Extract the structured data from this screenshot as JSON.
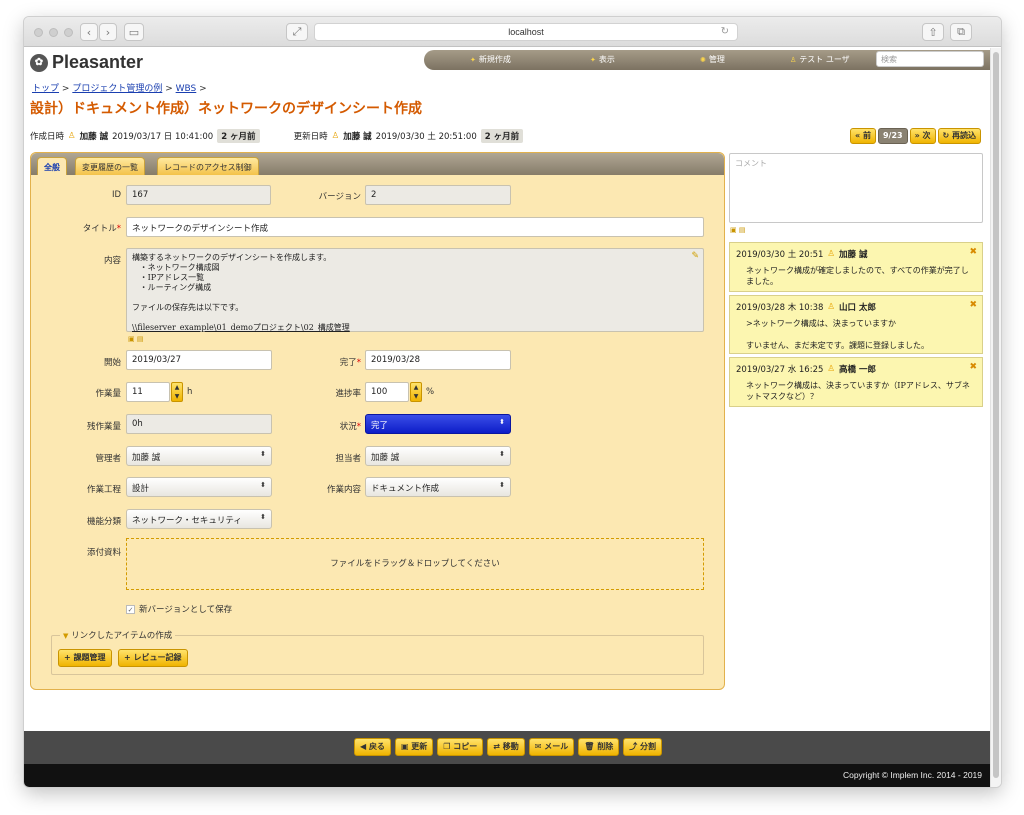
{
  "browser": {
    "url": "localhost"
  },
  "app": {
    "logo": "Pleasanter"
  },
  "nav": {
    "new": "新規作成",
    "view": "表示",
    "admin": "管理",
    "user": "テスト ユーザ",
    "search_placeholder": "検索"
  },
  "breadcrumb": {
    "top": "トップ",
    "example": "プロジェクト管理の例",
    "wbs": "WBS",
    "sep": ">"
  },
  "title": "設計）ドキュメント作成）ネットワークのデザインシート作成",
  "meta": {
    "created_label": "作成日時",
    "created_by": "加藤 誠",
    "created_at": "2019/03/17 日 10:41:00",
    "created_ago": "2 ヶ月前",
    "updated_label": "更新日時",
    "updated_by": "加藤 誠",
    "updated_at": "2019/03/30 土 20:51:00",
    "updated_ago": "2 ヶ月前"
  },
  "pager": {
    "prev": "前",
    "count": "9/23",
    "next": "次",
    "reload": "再読込"
  },
  "tabs": [
    "全般",
    "変更履歴の一覧",
    "レコードのアクセス制御"
  ],
  "form": {
    "id_label": "ID",
    "id": "167",
    "version_label": "バージョン",
    "version": "2",
    "title_label": "タイトル",
    "title": "ネットワークのデザインシート作成",
    "body_label": "内容",
    "body_lines": [
      "構築するネットワークのデザインシートを作成します。",
      "   ・ネットワーク構成図",
      "   ・IPアドレス一覧",
      "   ・ルーティング構成",
      "",
      "ファイルの保存先は以下です。",
      ""
    ],
    "body_link": "\\\\fileserver_example\\01_demoプロジェクト\\02_構成管理",
    "start_label": "開始",
    "start": "2019/03/27",
    "complete_label": "完了",
    "complete": "2019/03/28",
    "work_label": "作業量",
    "work": "11",
    "work_unit": "h",
    "progress_label": "進捗率",
    "progress": "100",
    "progress_unit": "%",
    "remain_label": "残作業量",
    "remain": "0h",
    "status_label": "状況",
    "status": "完了",
    "manager_label": "管理者",
    "manager": "加藤 誠",
    "owner_label": "担当者",
    "owner": "加藤 誠",
    "process_label": "作業工程",
    "process": "設計",
    "content_label": "作業内容",
    "content": "ドキュメント作成",
    "category_label": "機能分類",
    "category": "ネットワーク・セキュリティ",
    "attach_label": "添付資料",
    "dropzone": "ファイルをドラッグ＆ドロップしてください",
    "new_version": "新バージョンとして保存",
    "linked_legend": "リンクしたアイテムの作成",
    "linked_issue": "課題管理",
    "linked_review": "レビュー記録"
  },
  "comments": {
    "placeholder": "コメント",
    "items": [
      {
        "date": "2019/03/30 土 20:51",
        "author": "加藤 誠",
        "body": "ネットワーク構成が確定しましたので、すべての作業が完了しました。"
      },
      {
        "date": "2019/03/28 木 10:38",
        "author": "山口 太郎",
        "body": ">ネットワーク構成は、決まっていますか\n\nすいません、まだ未定です。課題に登録しました。"
      },
      {
        "date": "2019/03/27 水 16:25",
        "author": "高橋 一郎",
        "body": "ネットワーク構成は、決まっていますか（IPアドレス、サブネットマスクなど）？"
      }
    ]
  },
  "footer": {
    "back": "戻る",
    "update": "更新",
    "copy": "コピー",
    "move": "移動",
    "mail": "メール",
    "delete": "削除",
    "split": "分割",
    "copyright": "Copyright © Implem Inc. 2014 - 2019"
  },
  "colors": {
    "accent": "#f0b400",
    "title": "#d45a00",
    "panel": "#fce8b2",
    "status_bg": "#1a2bd8"
  }
}
